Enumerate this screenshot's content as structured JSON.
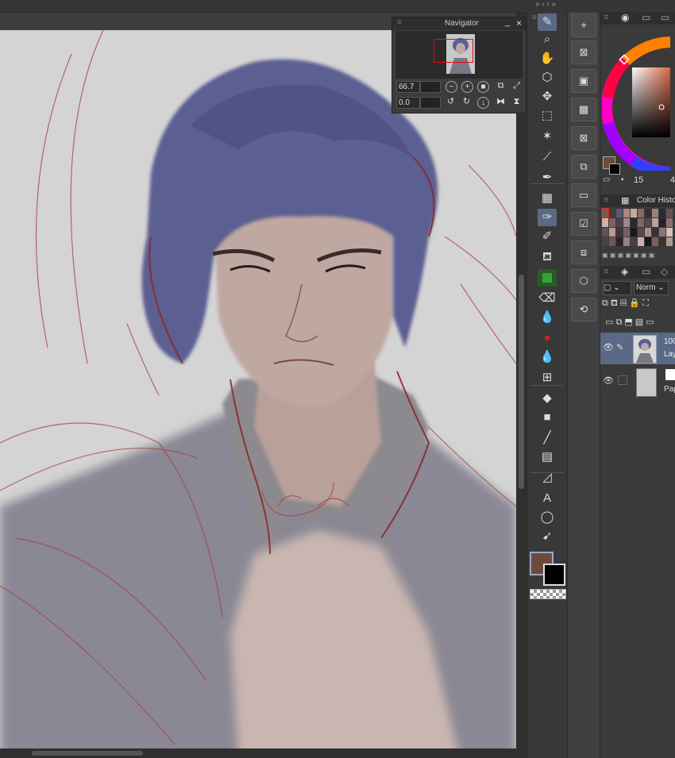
{
  "navigator": {
    "title": "Navigator",
    "zoom_value": "66.7",
    "rotation_value": "0.0",
    "minimize_glyph": "_",
    "close_glyph": "×"
  },
  "tools": [
    {
      "name": "pen-tool-icon",
      "glyph": "✎"
    },
    {
      "name": "zoom-tool-icon",
      "glyph": "⌕"
    },
    {
      "name": "hand-tool-icon",
      "glyph": "✋"
    },
    {
      "name": "rotate-tool-icon",
      "glyph": "⬡"
    },
    {
      "name": "move-tool-icon",
      "glyph": "✥"
    },
    {
      "name": "selection-tool-icon",
      "glyph": "⬚"
    },
    {
      "name": "magic-wand-tool-icon",
      "glyph": "✶"
    },
    {
      "name": "eyedropper-tool-icon",
      "glyph": "⟋"
    },
    {
      "name": "pencil-tool-icon",
      "glyph": "✒"
    },
    {
      "name": "pattern-tool-icon",
      "glyph": "▦"
    },
    {
      "name": "marker-tool-icon",
      "glyph": "✑"
    },
    {
      "name": "brush-tool-icon",
      "glyph": "✐"
    },
    {
      "name": "airbrush-tool-icon",
      "glyph": "⛾"
    },
    {
      "name": "decoration-tool-icon",
      "glyph": "▩"
    },
    {
      "name": "eraser-tool-icon",
      "glyph": "⌫"
    },
    {
      "name": "blend-tool-icon",
      "glyph": "💧"
    },
    {
      "name": "fill-color-tool-icon",
      "glyph": "●"
    },
    {
      "name": "smudge-tool-icon",
      "glyph": "💧"
    },
    {
      "name": "liquify-tool-icon",
      "glyph": "⊞"
    },
    {
      "name": "fill-tool-icon",
      "glyph": "◆"
    },
    {
      "name": "gradient-tool-icon",
      "glyph": "■"
    },
    {
      "name": "line-tool-icon",
      "glyph": "╱"
    },
    {
      "name": "frame-tool-icon",
      "glyph": "▤"
    },
    {
      "name": "ruler-tool-icon",
      "glyph": "◿"
    },
    {
      "name": "text-tool-icon",
      "glyph": "A"
    },
    {
      "name": "balloon-tool-icon",
      "glyph": "◯"
    },
    {
      "name": "operation-tool-icon",
      "glyph": "➹"
    }
  ],
  "colors": {
    "main": "#6e4a3c",
    "sub": "#000000",
    "accent": "#5a6a86"
  },
  "panel": {
    "color_history_tab": "Color Histo",
    "wheel_value_a": "15",
    "wheel_value_b": "4",
    "blend_mode": "Norm",
    "layer1_name": "100",
    "layer1_sub": "Lay",
    "layer2_name": "Pap"
  },
  "history_swatches": [
    "#7a5a50",
    "#4a3a38",
    "#5a5a70",
    "#b08880",
    "#c8a8a0",
    "#8a6a60",
    "#3a3030",
    "#9a8080",
    "#2a2a3a",
    "#6a5050",
    "#d0b0a8",
    "#806060",
    "#4a4050",
    "#a08888",
    "#302828",
    "#786868",
    "#5a4848",
    "#c0a098",
    "#282030",
    "#907070",
    "#605058",
    "#b89890",
    "#403838",
    "#706068",
    "#1a1818",
    "#584848",
    "#a89088",
    "#383040",
    "#887878",
    "#d8c0b8",
    "#504040",
    "#685860",
    "#282428",
    "#988080",
    "#484048",
    "#c8b0a8",
    "#181418",
    "#786060",
    "#3a3434",
    "#b09890"
  ]
}
